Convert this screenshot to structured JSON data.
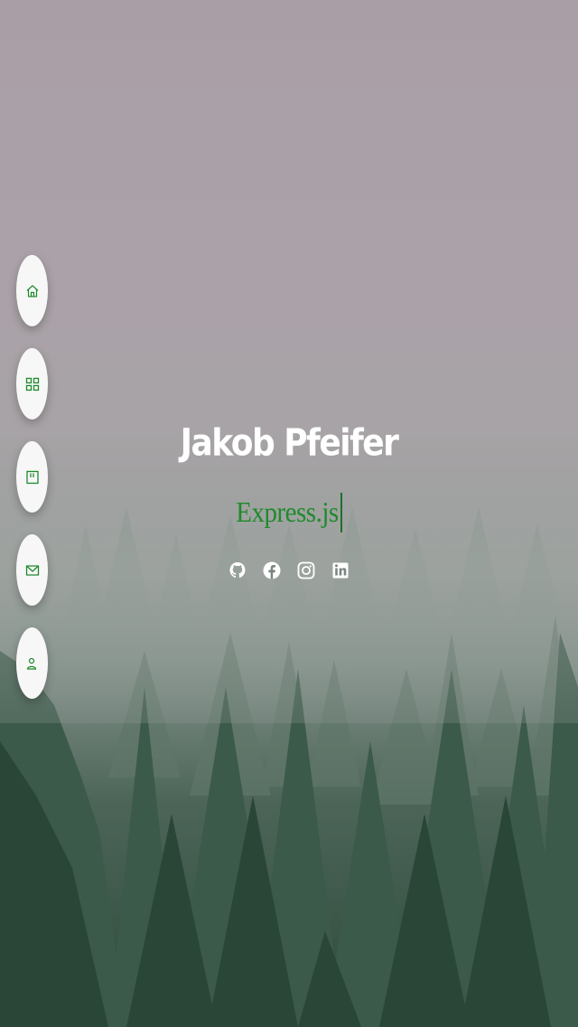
{
  "profile": {
    "name": "Jakob Pfeifer",
    "role_typed": "Express.js"
  },
  "nav": {
    "items": [
      {
        "name": "home",
        "icon": "home-icon"
      },
      {
        "name": "portfolio",
        "icon": "grid-icon"
      },
      {
        "name": "resume",
        "icon": "document-icon"
      },
      {
        "name": "contact",
        "icon": "mail-icon"
      },
      {
        "name": "about",
        "icon": "user-icon"
      }
    ]
  },
  "socials": [
    {
      "name": "github",
      "icon": "github-icon"
    },
    {
      "name": "facebook",
      "icon": "facebook-icon"
    },
    {
      "name": "instagram",
      "icon": "instagram-icon"
    },
    {
      "name": "linkedin",
      "icon": "linkedin-icon"
    }
  ],
  "colors": {
    "accent": "#1f8a2c",
    "name_text": "#ffffff",
    "nav_bg": "#f7f7f7"
  }
}
